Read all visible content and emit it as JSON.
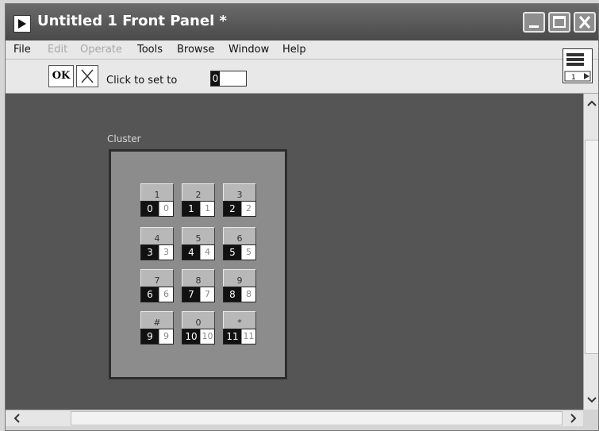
{
  "window": {
    "title": "Untitled 1 Front Panel *",
    "icons": [
      "run-icon",
      "minimize-icon",
      "maximize-icon",
      "close-icon"
    ]
  },
  "menu": {
    "items": [
      {
        "label": "File",
        "enabled": true
      },
      {
        "label": "Edit",
        "enabled": false
      },
      {
        "label": "Operate",
        "enabled": false
      },
      {
        "label": "Tools",
        "enabled": true
      },
      {
        "label": "Browse",
        "enabled": true
      },
      {
        "label": "Window",
        "enabled": true
      },
      {
        "label": "Help",
        "enabled": true
      }
    ]
  },
  "toolbar": {
    "ok_label": "OK",
    "cancel_icon": "x-icon",
    "click_label": "Click to set to",
    "value": "0"
  },
  "panel_icon": {
    "label": "1"
  },
  "cluster": {
    "label": "Cluster",
    "buttons": [
      {
        "cap": "1",
        "dark": "0",
        "light": "0"
      },
      {
        "cap": "2",
        "dark": "1",
        "light": "1"
      },
      {
        "cap": "3",
        "dark": "2",
        "light": "2"
      },
      {
        "cap": "4",
        "dark": "3",
        "light": "3"
      },
      {
        "cap": "5",
        "dark": "4",
        "light": "4"
      },
      {
        "cap": "6",
        "dark": "5",
        "light": "5"
      },
      {
        "cap": "7",
        "dark": "6",
        "light": "6"
      },
      {
        "cap": "8",
        "dark": "7",
        "light": "7"
      },
      {
        "cap": "9",
        "dark": "8",
        "light": "8"
      },
      {
        "cap": "#",
        "dark": "9",
        "light": "9"
      },
      {
        "cap": "0",
        "dark": "10",
        "light": "10"
      },
      {
        "cap": "*",
        "dark": "11",
        "light": "11"
      }
    ]
  },
  "colors": {
    "canvas": "#555555",
    "cluster_bg": "#8c8c8c",
    "titlebar": "#5a5a5a"
  }
}
